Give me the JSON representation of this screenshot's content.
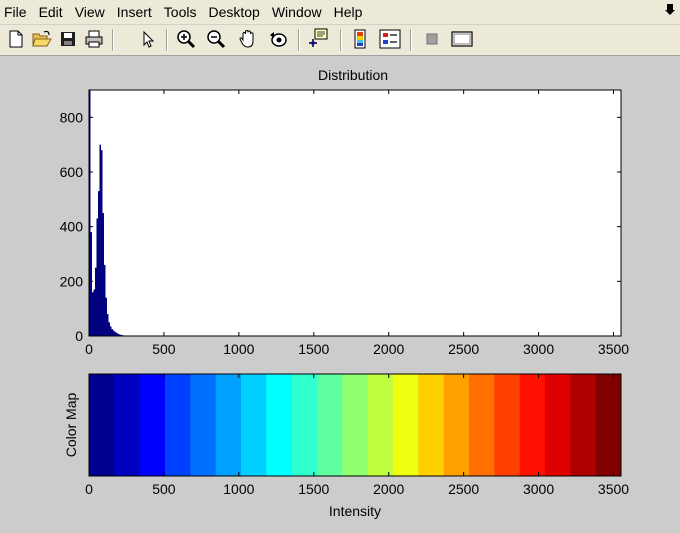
{
  "menubar": {
    "items": [
      "File",
      "Edit",
      "View",
      "Insert",
      "Tools",
      "Desktop",
      "Window",
      "Help"
    ]
  },
  "toolbar": {
    "buttons": [
      {
        "name": "new-figure-icon"
      },
      {
        "name": "open-file-icon"
      },
      {
        "name": "save-icon"
      },
      {
        "name": "print-icon"
      },
      {
        "name": "edit-plot-arrow-icon"
      },
      {
        "name": "zoom-in-icon"
      },
      {
        "name": "zoom-out-icon"
      },
      {
        "name": "pan-hand-icon"
      },
      {
        "name": "rotate-3d-icon"
      },
      {
        "name": "data-cursor-icon"
      },
      {
        "name": "insert-colorbar-icon"
      },
      {
        "name": "insert-legend-icon"
      },
      {
        "name": "hide-plot-tools-icon"
      },
      {
        "name": "show-plot-tools-icon"
      }
    ]
  },
  "chart_data": [
    {
      "type": "bar",
      "title": "Distribution",
      "xlabel": "",
      "ylabel": "",
      "xlim": [
        0,
        3550
      ],
      "ylim": [
        0,
        900
      ],
      "xticks": [
        0,
        500,
        1000,
        1500,
        2000,
        2500,
        3000,
        3500
      ],
      "yticks": [
        0,
        200,
        400,
        600,
        800
      ],
      "bar_color": "#000080",
      "bin_width": 10,
      "x": [
        0,
        10,
        20,
        30,
        40,
        50,
        60,
        70,
        80,
        90,
        100,
        110,
        120,
        130,
        140,
        150,
        160,
        170,
        180,
        190,
        200,
        210,
        220,
        230
      ],
      "values": [
        900,
        380,
        160,
        170,
        250,
        430,
        530,
        700,
        680,
        450,
        260,
        140,
        80,
        50,
        35,
        25,
        20,
        15,
        12,
        8,
        6,
        4,
        3,
        2
      ]
    },
    {
      "type": "heatmap",
      "title": "",
      "xlabel": "Intensity",
      "ylabel": "Color Map",
      "xlim": [
        0,
        3550
      ],
      "xticks": [
        0,
        500,
        1000,
        1500,
        2000,
        2500,
        3000,
        3500
      ],
      "colors": [
        "#00008f",
        "#0000bf",
        "#0000ff",
        "#0040ff",
        "#0070ff",
        "#00a0ff",
        "#00cfff",
        "#00ffff",
        "#30ffcf",
        "#60ff9f",
        "#90ff70",
        "#c0ff40",
        "#f0ff10",
        "#ffd000",
        "#ffa000",
        "#ff7000",
        "#ff4000",
        "#ff1000",
        "#df0000",
        "#af0000",
        "#800000"
      ]
    }
  ]
}
